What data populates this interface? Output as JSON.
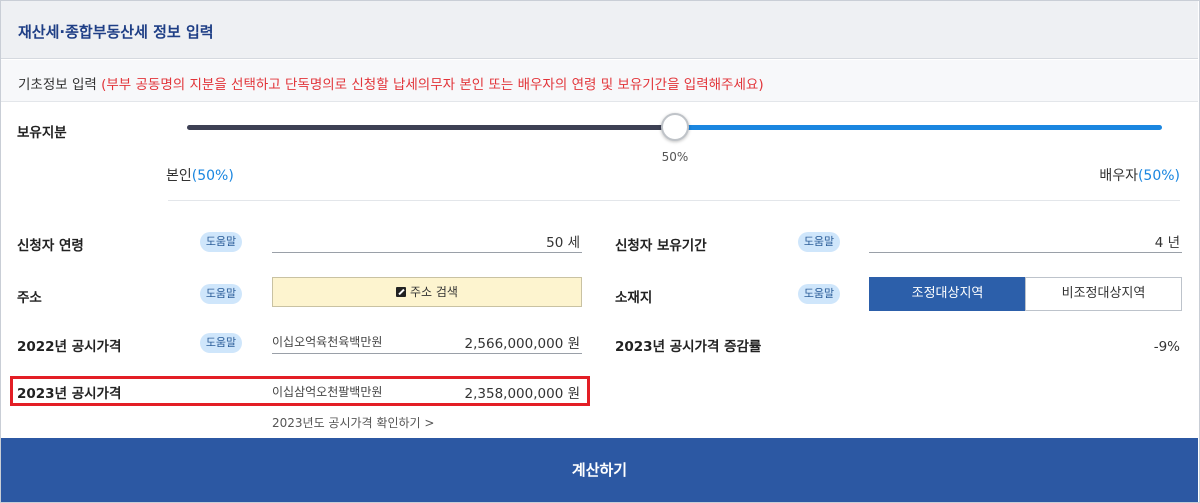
{
  "header": {
    "title": "재산세·종합부동산세 정보 입력"
  },
  "subhead": {
    "label": "기초정보 입력",
    "note": "(부부 공동명의 지분을 선택하고 단독명의로 신청할 납세의무자 본인 또는 배우자의 연령 및 보유기간을 입력해주세요)"
  },
  "ownership": {
    "label": "보유지분",
    "slider_fraction": 0.5,
    "value_label": "50%",
    "left_label": "본인",
    "left_pct": "(50%)",
    "right_label": "배우자",
    "right_pct": "(50%)"
  },
  "help_label": "도움말",
  "applicant_age": {
    "label": "신청자 연령",
    "value": "50 세"
  },
  "holding_period": {
    "label": "신청자 보유기간",
    "value": "4 년"
  },
  "address": {
    "label": "주소",
    "button_label": "주소 검색"
  },
  "location": {
    "label": "소재지",
    "options": [
      "조정대상지역",
      "비조정대상지역"
    ],
    "selected": "조정대상지역"
  },
  "price_2022": {
    "label": "2022년 공시가격",
    "text": "이십오억육천육백만원",
    "value": "2,566,000,000 원"
  },
  "change_rate": {
    "label": "2023년 공시가격 증감률",
    "value": "-9%"
  },
  "price_2023": {
    "label": "2023년 공시가격",
    "text": "이십삼억오천팔백만원",
    "value": "2,358,000,000 원"
  },
  "check_link": "2023년도 공시가격 확인하기 >",
  "calculate_button": "계산하기",
  "colors": {
    "primary": "#2c58a3",
    "accent": "#1a86e0",
    "warning": "#e2353a",
    "highlight": "#e31e25"
  }
}
